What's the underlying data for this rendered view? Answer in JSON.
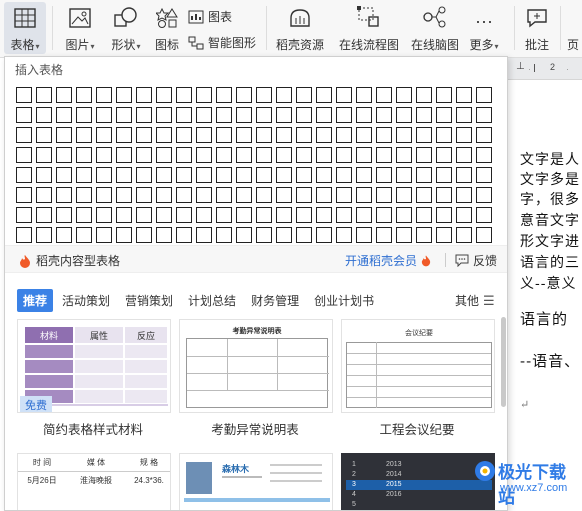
{
  "ribbon": {
    "table": "表格",
    "picture": "图片",
    "shapes": "形状",
    "icons": "图标",
    "chart": "图表",
    "smart_shape": "智能图形",
    "resources": "稻壳资源",
    "flowchart": "在线流程图",
    "mindmap": "在线脑图",
    "more": "更多",
    "comment": "批注",
    "page_partial": "页"
  },
  "panel": {
    "title": "插入表格",
    "grid_cols": 24,
    "grid_rows": 8,
    "promo_left": "稻壳内容型表格",
    "promo_member": "开通稻壳会员",
    "promo_feedback": "反馈",
    "tabs": [
      "推荐",
      "活动策划",
      "营销策划",
      "计划总结",
      "财务管理",
      "创业计划书"
    ],
    "more": "其他",
    "cards": [
      {
        "caption": "简约表格样式材料",
        "badge": "免费",
        "h1": "材料",
        "h2": "属性",
        "h3": "反应"
      },
      {
        "caption": "考勤异常说明表",
        "title": "考勤异常说明表"
      },
      {
        "caption": "工程会议纪要",
        "title": "会议纪要"
      }
    ],
    "card4": {
      "c1": "时  间",
      "c2": "媒  体",
      "c3": "规  格",
      "r1": "5月26日",
      "r2": "淮海晚报",
      "r3": "24.3*36."
    },
    "card5": {
      "name": "森林木"
    },
    "card6": {
      "rows": [
        "1",
        "2",
        "3",
        "4",
        "5"
      ],
      "years": [
        "2013",
        "2014",
        "2015",
        "2016"
      ]
    }
  },
  "document": {
    "ruler_mark": "2",
    "lines": [
      "文字是人",
      "文字多是",
      "字，很多",
      "意音文字",
      "形文字进",
      "语言的三",
      "义--意义",
      "语言的",
      "--语音、",
      "↵"
    ]
  },
  "watermark": {
    "text": "极光下载站",
    "url": "www.xz7.com"
  },
  "colors": {
    "accent": "#3b82e6",
    "promo_fire": "#f05a28",
    "card1_header": "#8f6fb0"
  }
}
